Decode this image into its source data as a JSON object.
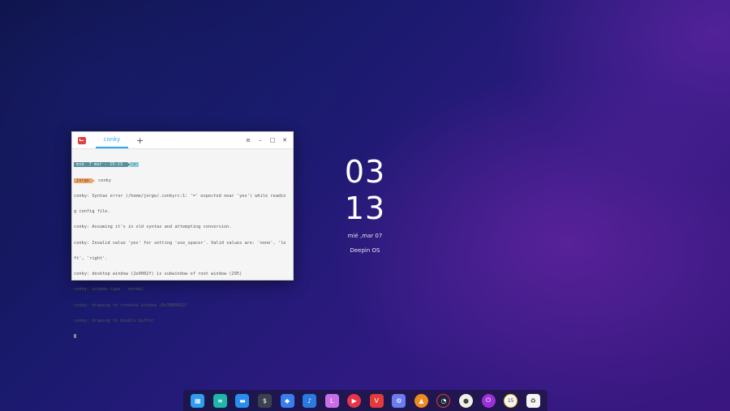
{
  "terminal": {
    "tab_label": "conky",
    "new_tab_symbol": "+",
    "menu_symbol": "≡",
    "minimize_symbol": "–",
    "maximize_symbol": "□",
    "close_symbol": "✕",
    "prompt": {
      "day": "mié",
      "date": "7 mar",
      "time_sep": "-",
      "time": "15:13",
      "tail": "»",
      "user": "jorge",
      "command": "conky"
    },
    "output_lines": [
      "conky: Syntax error (/home/jorge/.conkyrc:1: '=' expected near 'yes') while readin",
      "g config file.",
      "conky: Assuming it's in old syntax and attempting conversion.",
      "conky: Invalid value 'yes' for setting 'use_spacer'. Valid values are: 'none', 'le",
      "ft', 'right'.",
      "conky: desktop window (2e0002f) is subwindow of root window (295)",
      "conky: window type - normal",
      "conky: drawing to created window (0x7800002)",
      "conky: drawing to double buffer"
    ]
  },
  "clock": {
    "hours": "03",
    "minutes": "13",
    "date": "mié ,mar 07",
    "os_name": "Deepin OS"
  },
  "dock": {
    "items": [
      {
        "name": "launcher-icon",
        "color": "#2f9cf0",
        "glyph": "▦"
      },
      {
        "name": "multitasking-icon",
        "color": "#1fb5a8",
        "glyph": "≡"
      },
      {
        "name": "file-manager-icon",
        "color": "#2a8ef0",
        "glyph": "▬"
      },
      {
        "name": "terminal-icon",
        "color": "#3c4150",
        "glyph": "$"
      },
      {
        "name": "app-store-icon",
        "color": "#3a7df0",
        "glyph": "◆"
      },
      {
        "name": "music-icon",
        "color": "#2a7ae0",
        "glyph": "♪"
      },
      {
        "name": "l-app-icon",
        "color": "#c86fe6",
        "glyph": "L"
      },
      {
        "name": "video-player-icon",
        "color": "#e8344a",
        "glyph": "▶"
      },
      {
        "name": "vivaldi-icon",
        "color": "#e43a3a",
        "glyph": "V"
      },
      {
        "name": "settings-icon",
        "color": "#6a7cf0",
        "glyph": "⚙"
      },
      {
        "name": "vlc-icon",
        "color": "#f08a1e",
        "glyph": "▲"
      },
      {
        "name": "clock-app-icon",
        "color": "#1a2340",
        "glyph": "◔"
      },
      {
        "name": "disk-icon",
        "color": "#f2f0e6",
        "glyph": "●"
      },
      {
        "name": "power-icon",
        "color": "#9b30d8",
        "glyph": "⏻"
      },
      {
        "name": "calendar-icon",
        "color": "#f5f5f5",
        "glyph": "15"
      },
      {
        "name": "trash-icon",
        "color": "#f5f5f5",
        "glyph": "♻"
      }
    ]
  }
}
